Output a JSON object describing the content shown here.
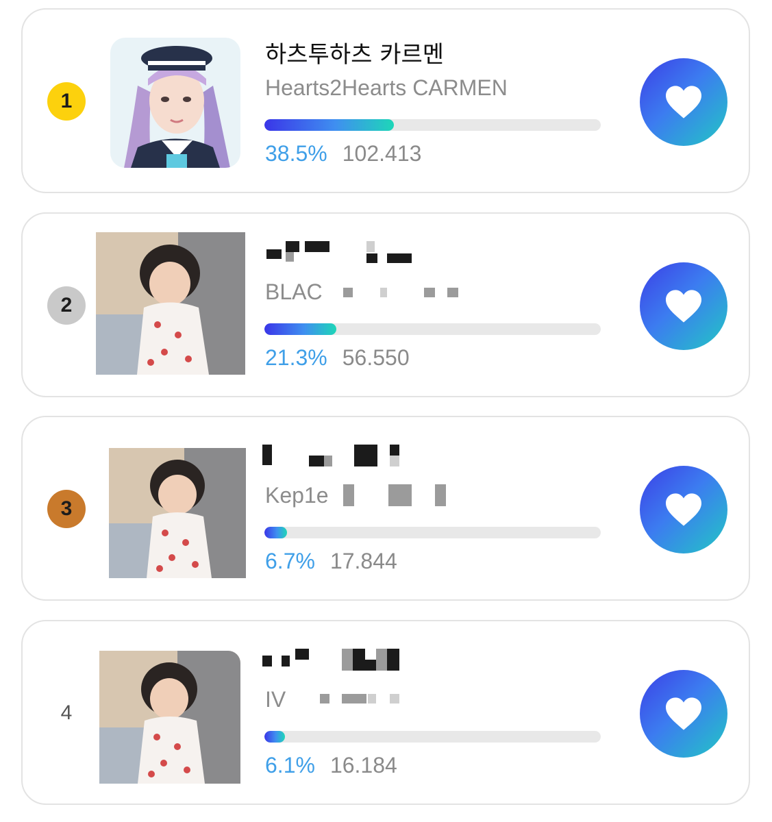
{
  "brand_colors": {
    "bar_gradient": [
      "#3a36e8",
      "#3f8ff0",
      "#1ed6b8"
    ],
    "heart_gradient": [
      "#3b3fe6",
      "#3c7cf0",
      "#22c7c4"
    ],
    "percent_color": "#3f9fe8",
    "rank_gold": "#fcd10d",
    "rank_silver": "#c9c9c9",
    "rank_bronze": "#c97a2c"
  },
  "entries": [
    {
      "rank": "1",
      "name": "하츠투하츠 카르멘",
      "subname": "Hearts2Hearts CARMEN",
      "percent": "38.5%",
      "percent_value": 38.5,
      "votes": "102.413",
      "icon": "heart-icon"
    },
    {
      "rank": "2",
      "name": "",
      "subname": "BLAC",
      "percent": "21.3%",
      "percent_value": 21.3,
      "votes": "56.550",
      "icon": "heart-icon"
    },
    {
      "rank": "3",
      "name": "",
      "subname": "Kep1e",
      "percent": "6.7%",
      "percent_value": 6.7,
      "votes": "17.844",
      "icon": "heart-icon"
    },
    {
      "rank": "4",
      "name": "",
      "subname": "IV",
      "percent": "6.1%",
      "percent_value": 6.1,
      "votes": "16.184",
      "icon": "heart-icon"
    }
  ]
}
